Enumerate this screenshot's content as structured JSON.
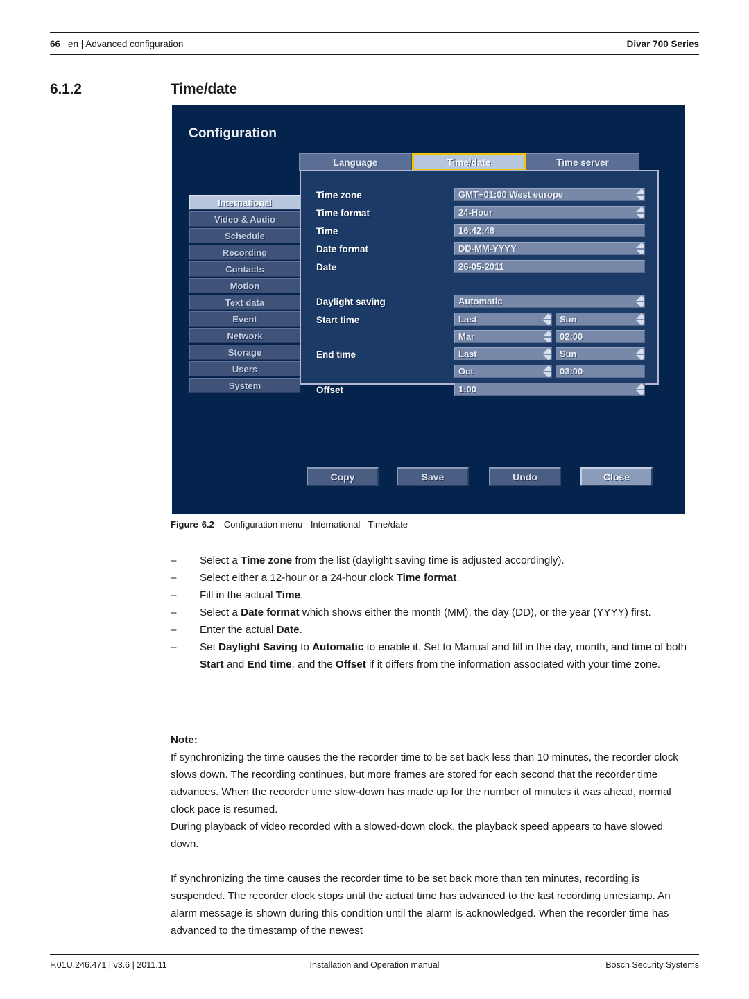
{
  "header": {
    "page_number": "66",
    "breadcrumb": "en | Advanced configuration",
    "product": "Divar 700 Series"
  },
  "section": {
    "number": "6.1.2",
    "title": "Time/date"
  },
  "screenshot": {
    "title": "Configuration",
    "tabs": [
      {
        "label": "Language",
        "selected": false
      },
      {
        "label": "Time/date",
        "selected": true
      },
      {
        "label": "Time server",
        "selected": false
      }
    ],
    "sidebar": [
      {
        "label": "International",
        "active": true
      },
      {
        "label": "Video & Audio",
        "active": false
      },
      {
        "label": "Schedule",
        "active": false
      },
      {
        "label": "Recording",
        "active": false
      },
      {
        "label": "Contacts",
        "active": false
      },
      {
        "label": "Motion",
        "active": false
      },
      {
        "label": "Text data",
        "active": false
      },
      {
        "label": "Event",
        "active": false
      },
      {
        "label": "Network",
        "active": false
      },
      {
        "label": "Storage",
        "active": false
      },
      {
        "label": "Users",
        "active": false
      },
      {
        "label": "System",
        "active": false
      }
    ],
    "fields": {
      "time_zone_label": "Time zone",
      "time_zone_value": "GMT+01:00 West europe",
      "time_format_label": "Time format",
      "time_format_value": "24-Hour",
      "time_label": "Time",
      "time_value": "16:42:48",
      "date_format_label": "Date format",
      "date_format_value": "DD-MM-YYYY",
      "date_label": "Date",
      "date_value": "26-05-2011",
      "daylight_saving_label": "Daylight saving",
      "daylight_saving_value": "Automatic",
      "start_time_label": "Start time",
      "start_week_value": "Last",
      "start_day_value": "Sun",
      "start_month_value": "Mar",
      "start_clock_value": "02:00",
      "end_time_label": "End time",
      "end_week_value": "Last",
      "end_day_value": "Sun",
      "end_month_value": "Oct",
      "end_clock_value": "03:00",
      "offset_label": "Offset",
      "offset_value": "1:00"
    },
    "buttons": [
      {
        "label": "Copy",
        "focused": false
      },
      {
        "label": "Save",
        "focused": false
      },
      {
        "label": "Undo",
        "focused": false
      },
      {
        "label": "Close",
        "focused": true
      }
    ],
    "colors": {
      "background": "#04244e",
      "dialog": "#1b3b66",
      "field": "#7888a8",
      "focus_outline": "#f5c400",
      "selected_tab": "#b9c7de"
    }
  },
  "figure": {
    "label": "Figure",
    "number": "6.2",
    "caption": "Configuration menu - International - Time/date"
  },
  "bullets": {
    "dash": "–",
    "b1_a": "Select a ",
    "b1_b": "Time zone",
    "b1_c": " from the list (daylight saving time is adjusted accordingly).",
    "b2_a": "Select either a 12-hour or a 24-hour clock ",
    "b2_b": "Time format",
    "b2_c": ".",
    "b3_a": "Fill in the actual ",
    "b3_b": "Time",
    "b3_c": ".",
    "b4_a": "Select a ",
    "b4_b": "Date format",
    "b4_c": " which shows either the month (MM), the day (DD), or the year (YYYY) first.",
    "b5_a": "Enter the actual ",
    "b5_b": "Date",
    "b5_c": ".",
    "b6_a": "Set ",
    "b6_b": "Daylight Saving",
    "b6_c": " to ",
    "b6_d": "Automatic",
    "b6_e": " to enable it. Set to Manual and fill in the day, month, and time of both ",
    "b6_f": "Start",
    "b6_g": " and ",
    "b6_h": "End time",
    "b6_i": ", and the ",
    "b6_j": "Offset",
    "b6_k": " if it differs from the information associated with your time zone."
  },
  "note": {
    "label": "Note:",
    "para1": "If synchronizing the time causes the the recorder time to be set back less than 10 minutes, the recorder clock slows down. The recording continues, but more frames are stored for each second that the recorder time advances. When the recorder time slow-down has made up for the number of minutes it was ahead, normal clock pace is resumed.",
    "para2": "During playback of video recorded with a slowed-down clock, the playback speed appears to have slowed down.",
    "para3": "If synchronizing the time causes the recorder time to be set back more than ten minutes, recording is suspended. The recorder clock stops until the actual time has advanced to the last recording timestamp. An alarm message is shown during this condition until the alarm is acknowledged. When the recorder time has advanced to the timestamp of the newest"
  },
  "footer": {
    "left": "F.01U.246.471 | v3.6 | 2011.11",
    "center": "Installation and Operation manual",
    "right": "Bosch Security Systems"
  }
}
